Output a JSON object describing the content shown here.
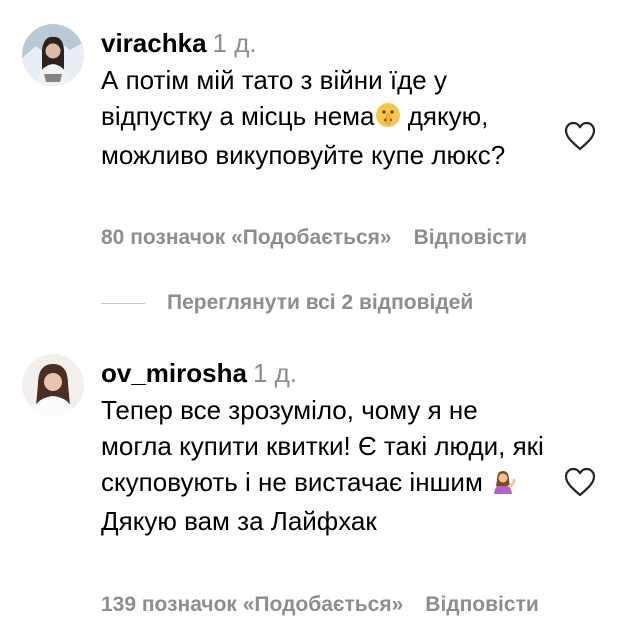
{
  "comments": [
    {
      "username": "virachka",
      "time": "1 д.",
      "text_before_emoji": "А потім мій тато з війни їде у відпустку а місць нема",
      "emoji_icon": "shushing-face-emoji",
      "text_after_emoji": " дякую, можливо викуповуйте купе люкс?",
      "likes": "80 позначок «Подобається»",
      "reply_label": "Відповісти",
      "like_icon": "heart-outline-icon"
    },
    {
      "username": "ov_mirosha",
      "time": "1 д.",
      "text_before_emoji": "Тепер все зрозуміло, чому я не могла купити квитки! Є такі люди, які скуповують і не вистачає іншим ",
      "emoji_icon": "person-tipping-hand-emoji",
      "text_after_emoji": " Дякую вам за Лайфхак",
      "likes": "139 позначок «Подобається»",
      "reply_label": "Відповісти",
      "like_icon": "heart-outline-icon"
    }
  ],
  "view_replies": {
    "label": "Переглянути всі 2 відповідей"
  },
  "colors": {
    "text": "#000000",
    "secondary": "#8e8e8e",
    "divider": "#c7c7c7"
  }
}
